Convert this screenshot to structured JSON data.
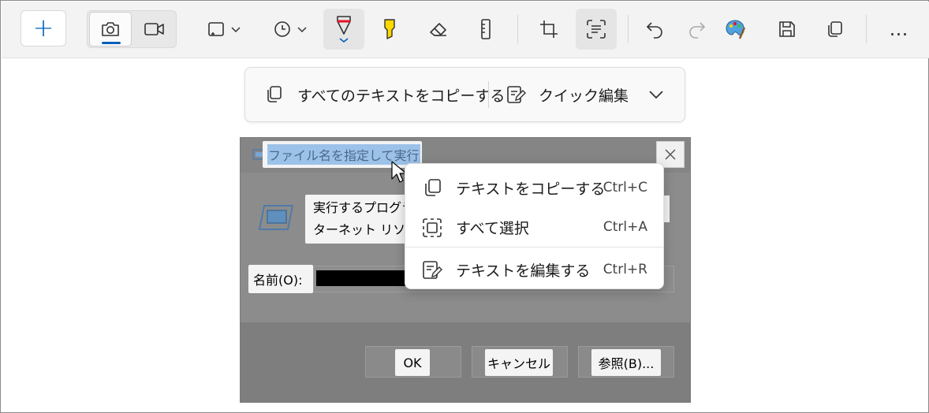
{
  "toolbar": {
    "new_label": "+",
    "more_label": "…",
    "colors": {
      "accent": "#005fb8",
      "pen_red": "#e81123",
      "highlighter": "#ffd800"
    }
  },
  "ocr_bar": {
    "copy_all_label": "すべてのテキストをコピーする",
    "quick_edit_label": "クイック編集"
  },
  "captured": {
    "title": "ファイル名を指定して実行",
    "desc_line1": "実行するプログラ",
    "desc_line2": "ターネット リソース",
    "name_label": "名前(O):",
    "ok_label": "OK",
    "cancel_label": "キャンセル",
    "browse_label": "参照(B)..."
  },
  "context_menu": {
    "items": [
      {
        "label": "テキストをコピーする",
        "shortcut": "Ctrl+C"
      },
      {
        "label": "すべて選択",
        "shortcut": "Ctrl+A"
      },
      {
        "label": "テキストを編集する",
        "shortcut": "Ctrl+R"
      }
    ]
  }
}
